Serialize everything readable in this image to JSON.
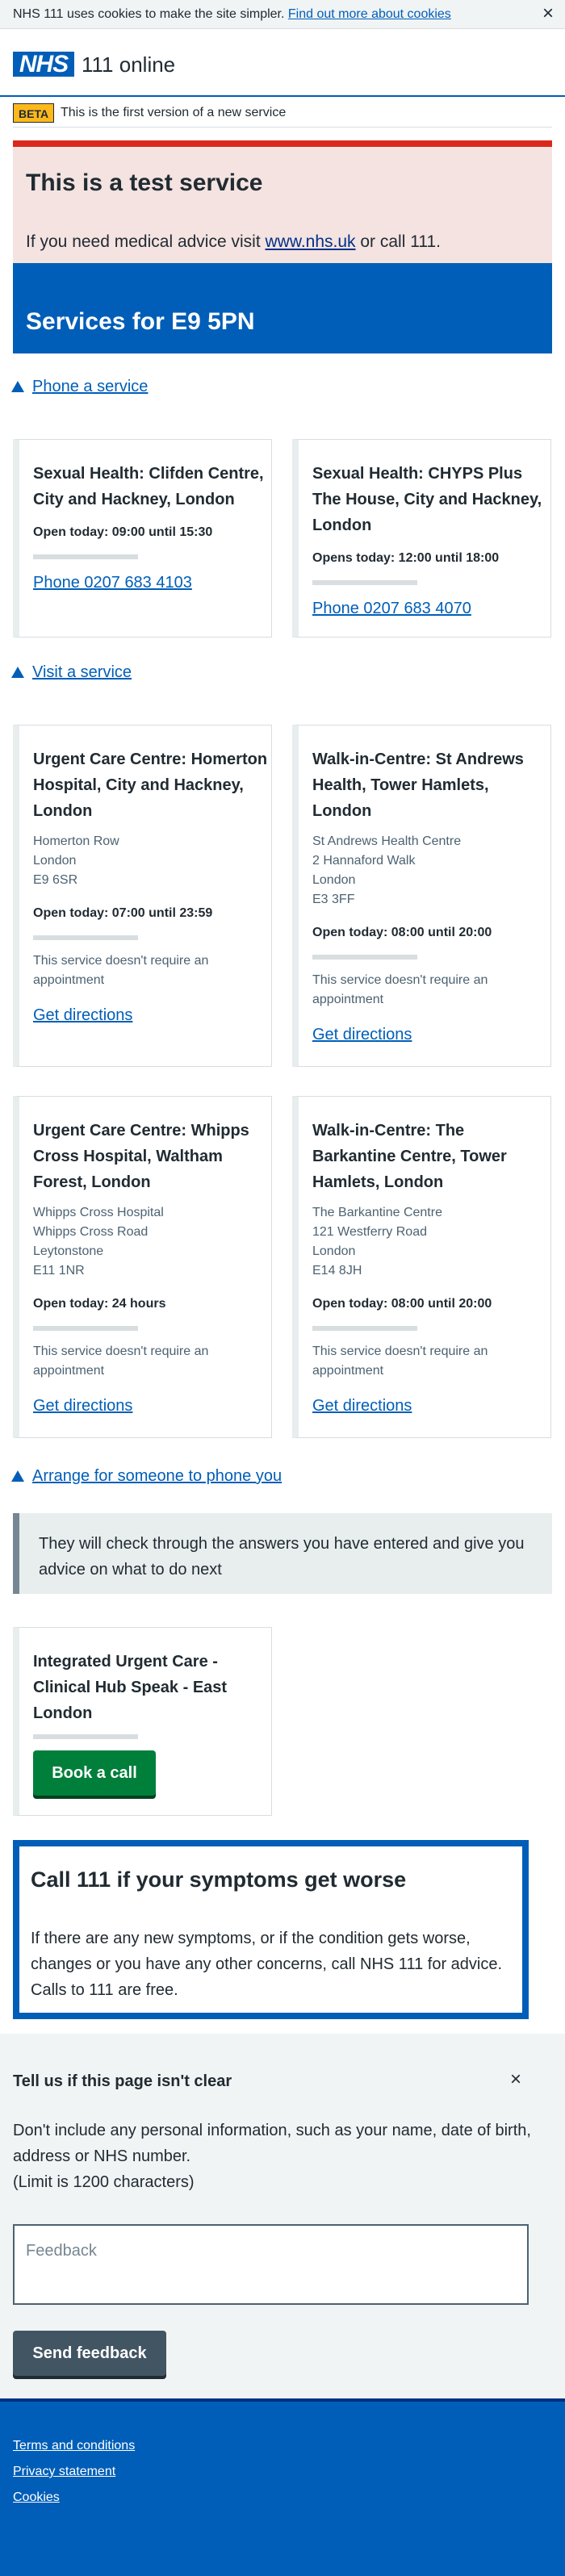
{
  "cookie_banner": {
    "text": "NHS 111 uses cookies to make the site simpler.",
    "link": "Find out more about cookies",
    "close_glyph": "×"
  },
  "header": {
    "logo": "NHS",
    "service_name": "111 online"
  },
  "phase_banner": {
    "tag": "BETA",
    "text": "This is the first version of a new service"
  },
  "test_banner": {
    "title": "This is a test service",
    "text_before": "If you need medical advice visit ",
    "link": "www.nhs.uk",
    "text_after": " or call 111."
  },
  "services_banner": {
    "title": "Services for E9 5PN"
  },
  "phone_section": {
    "heading": "Phone a service",
    "cards": [
      {
        "title": "Sexual Health: Clifden Centre, City and Hackney, London",
        "open": "Open today: 09:00 until 15:30",
        "phone": "Phone 0207 683 4103"
      },
      {
        "title": "Sexual Health: CHYPS Plus The House, City and Hackney, London",
        "open": "Opens today: 12:00 until 18:00",
        "phone": "Phone 0207 683 4070"
      }
    ]
  },
  "visit_section": {
    "heading": "Visit a service",
    "cards": [
      {
        "title": "Urgent Care Centre: Homerton Hospital, City and Hackney, London",
        "address": [
          "Homerton Row",
          "London",
          "E9 6SR"
        ],
        "open": "Open today: 07:00 until 23:59",
        "note": "This service doesn't require an appointment",
        "directions": "Get directions"
      },
      {
        "title": "Walk-in-Centre: St Andrews Health, Tower Hamlets, London",
        "address": [
          "St Andrews Health Centre",
          "2 Hannaford Walk",
          "London",
          "E3 3FF"
        ],
        "open": "Open today: 08:00 until 20:00",
        "note": "This service doesn't require an appointment",
        "directions": "Get directions"
      },
      {
        "title": "Urgent Care Centre: Whipps Cross Hospital, Waltham Forest, London",
        "address": [
          "Whipps Cross Hospital",
          "Whipps Cross Road",
          "Leytonstone",
          "E11 1NR"
        ],
        "open": "Open today: 24 hours",
        "note": "This service doesn't require an appointment",
        "directions": "Get directions"
      },
      {
        "title": "Walk-in-Centre: The Barkantine Centre, Tower Hamlets, London",
        "address": [
          "The Barkantine Centre",
          "121 Westferry Road",
          "London",
          "E14 8JH"
        ],
        "open": "Open today: 08:00 until 20:00",
        "note": "This service doesn't require an appointment",
        "directions": "Get directions"
      }
    ]
  },
  "callback_section": {
    "heading": "Arrange for someone to phone you",
    "inset": "They will check through the answers you have entered and give you advice on what to do next",
    "card": {
      "title": "Integrated Urgent Care - Clinical Hub Speak - East London",
      "button": "Book a call"
    }
  },
  "call111": {
    "title": "Call 111 if your symptoms get worse",
    "text": "If there are any new symptoms, or if the condition gets worse, changes or you have any other concerns, call NHS 111 for advice. Calls to 111 are free."
  },
  "feedback": {
    "title": "Tell us if this page isn't clear",
    "close_glyph": "×",
    "help": "Don't include any personal information, such as your name, date of birth, address or NHS number.",
    "limit": "(Limit is 1200 characters)",
    "placeholder": "Feedback",
    "button": "Send feedback"
  },
  "footer": {
    "links": [
      "Terms and conditions",
      "Privacy statement",
      "Cookies"
    ]
  },
  "colors": {
    "nhs_blue": "#005eb8",
    "dark_blue": "#003087",
    "green": "#007f3b",
    "red": "#da291c",
    "beta_yellow": "#ffb81c"
  }
}
